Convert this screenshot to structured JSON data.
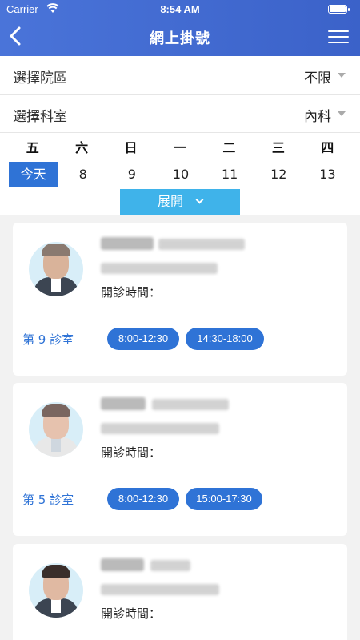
{
  "status": {
    "carrier": "Carrier",
    "time": "8:54 AM"
  },
  "nav": {
    "title": "網上掛號"
  },
  "filters": [
    {
      "label": "選擇院區",
      "value": "不限"
    },
    {
      "label": "選擇科室",
      "value": "內科"
    }
  ],
  "week": {
    "days": [
      "五",
      "六",
      "日",
      "一",
      "二",
      "三",
      "四"
    ],
    "dates": [
      "今天",
      "8",
      "9",
      "10",
      "11",
      "12",
      "13"
    ],
    "expand_label": "展開"
  },
  "doctors": [
    {
      "hours_label": "開診時間：",
      "room": "第 9 診室",
      "slots": [
        "8:00-12:30",
        "14:30-18:00"
      ]
    },
    {
      "hours_label": "開診時間：",
      "room": "第 5 診室",
      "slots": [
        "8:00-12:30",
        "15:00-17:30"
      ]
    },
    {
      "hours_label": "開診時間："
    }
  ],
  "colors": {
    "accent": "#2f73d6",
    "nav": "#4a74d9",
    "expand": "#3fb3ea"
  },
  "icons": {
    "back": "chevron-left-icon",
    "menu": "hamburger-menu-icon",
    "wifi": "wifi-icon",
    "battery": "battery-icon"
  }
}
